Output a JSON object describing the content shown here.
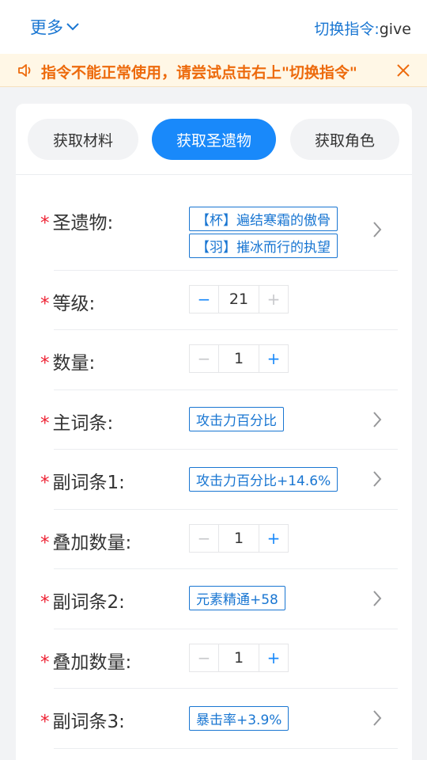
{
  "header": {
    "more_label": "更多",
    "switch_label": "切换指令:",
    "switch_value": "give"
  },
  "notice": {
    "text": "指令不能正常使用，请尝试点击右上\"切换指令\"",
    "color": "#ed6a0c"
  },
  "tabs": [
    {
      "label": "获取材料",
      "active": false
    },
    {
      "label": "获取圣遗物",
      "active": true
    },
    {
      "label": "获取角色",
      "active": false
    }
  ],
  "form": {
    "artifact": {
      "label": "圣遗物:",
      "tags": [
        "【杯】遍结寒霜的傲骨",
        "【羽】摧冰而行的执望"
      ]
    },
    "level": {
      "label": "等级:",
      "value": "21",
      "minus": "−",
      "plus": "+"
    },
    "quantity": {
      "label": "数量:",
      "value": "1",
      "minus": "−",
      "plus": "+"
    },
    "main_stat": {
      "label": "主词条:",
      "tag": "攻击力百分比"
    },
    "sub1": {
      "label": "副词条1:",
      "tag": "攻击力百分比+14.6%"
    },
    "stack1": {
      "label": "叠加数量:",
      "value": "1",
      "minus": "−",
      "plus": "+"
    },
    "sub2": {
      "label": "副词条2:",
      "tag": "元素精通+58"
    },
    "stack2": {
      "label": "叠加数量:",
      "value": "1",
      "minus": "−",
      "plus": "+"
    },
    "sub3": {
      "label": "副词条3:",
      "tag": "暴击率+3.9%"
    }
  },
  "required_mark": "*",
  "colors": {
    "accent": "#1989fa",
    "link": "#1976d2",
    "required": "#ee2233"
  }
}
